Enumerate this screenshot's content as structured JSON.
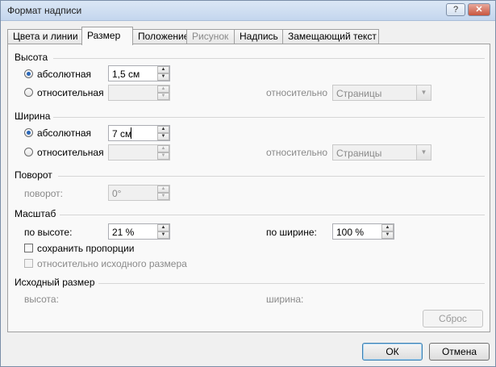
{
  "window": {
    "title": "Формат надписи",
    "help_button": "?",
    "close_button": "✕"
  },
  "tabs": [
    {
      "label": "Цвета и линии",
      "state": "normal"
    },
    {
      "label": "Размер",
      "state": "active"
    },
    {
      "label": "Положение",
      "state": "normal"
    },
    {
      "label": "Рисунок",
      "state": "disabled"
    },
    {
      "label": "Надпись",
      "state": "normal"
    },
    {
      "label": "Замещающий текст",
      "state": "normal"
    }
  ],
  "height": {
    "section_title": "Высота",
    "absolute_label": "абсолютная",
    "absolute_value": "1,5 см",
    "relative_label": "относительная",
    "relative_value": "",
    "relative_to_label": "относительно",
    "relative_to_value": "Страницы"
  },
  "width": {
    "section_title": "Ширина",
    "absolute_label": "абсолютная",
    "absolute_value": "7 см",
    "relative_label": "относительная",
    "relative_value": "",
    "relative_to_label": "относительно",
    "relative_to_value": "Страницы"
  },
  "rotation": {
    "section_title": "Поворот",
    "rotation_label": "поворот:",
    "rotation_value": "0°"
  },
  "scale": {
    "section_title": "Масштаб",
    "height_label": "по высоте:",
    "height_value": "21 %",
    "width_label": "по ширине:",
    "width_value": "100 %",
    "lock_aspect_label": "сохранить пропорции",
    "relative_original_label": "относительно исходного размера"
  },
  "original_size": {
    "section_title": "Исходный размер",
    "height_label": "высота:",
    "width_label": "ширина:",
    "reset_label": "Сброс"
  },
  "footer": {
    "ok_label": "ОК",
    "cancel_label": "Отмена"
  }
}
